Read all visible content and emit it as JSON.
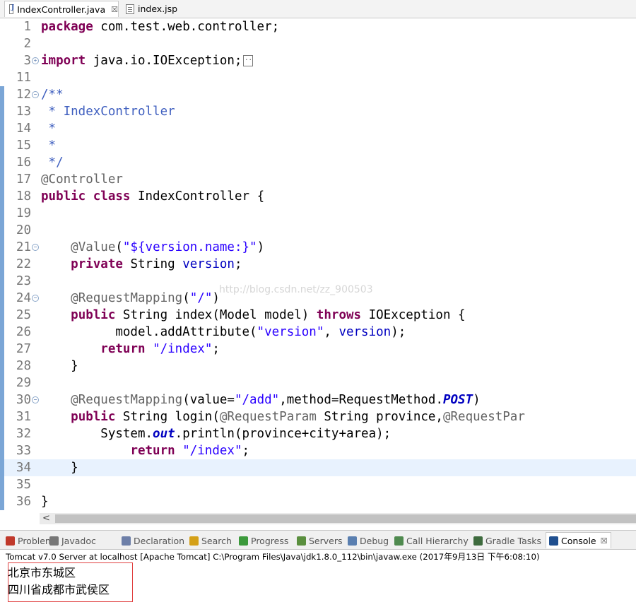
{
  "editor_tabs": [
    {
      "label": "IndexController.java",
      "close": "☒",
      "active": true
    },
    {
      "label": "index.jsp",
      "active": false
    }
  ],
  "code_lines": [
    {
      "n": "1",
      "tokens": [
        [
          "kw",
          "package"
        ],
        [
          "t",
          " com.test.web.controller;"
        ]
      ]
    },
    {
      "n": "2",
      "tokens": []
    },
    {
      "n": "3",
      "fold": "+",
      "tokens": [
        [
          "kw",
          "import"
        ],
        [
          "t",
          " java.io.IOException;"
        ]
      ],
      "collapsed": true
    },
    {
      "n": "11",
      "tokens": []
    },
    {
      "n": "12",
      "fold": "−",
      "bar": true,
      "tokens": [
        [
          "cm",
          "/**"
        ]
      ]
    },
    {
      "n": "13",
      "bar": true,
      "tokens": [
        [
          "cm",
          " * IndexController"
        ]
      ]
    },
    {
      "n": "14",
      "bar": true,
      "tokens": [
        [
          "cm",
          " *"
        ]
      ]
    },
    {
      "n": "15",
      "bar": true,
      "tokens": [
        [
          "cm",
          " *"
        ]
      ]
    },
    {
      "n": "16",
      "bar": true,
      "tokens": [
        [
          "cm",
          " */"
        ]
      ]
    },
    {
      "n": "17",
      "bar": true,
      "tokens": [
        [
          "an",
          "@Controller"
        ]
      ]
    },
    {
      "n": "18",
      "bar": true,
      "tokens": [
        [
          "kw",
          "public"
        ],
        [
          "t",
          " "
        ],
        [
          "kw",
          "class"
        ],
        [
          "t",
          " IndexController {"
        ]
      ]
    },
    {
      "n": "19",
      "bar": true,
      "tokens": []
    },
    {
      "n": "20",
      "bar": true,
      "tokens": []
    },
    {
      "n": "21",
      "fold": "−",
      "bar": true,
      "tokens": [
        [
          "t",
          "    "
        ],
        [
          "an",
          "@Value"
        ],
        [
          "t",
          "("
        ],
        [
          "st",
          "\"${version.name:}\""
        ],
        [
          "t",
          ")"
        ]
      ]
    },
    {
      "n": "22",
      "bar": true,
      "tokens": [
        [
          "t",
          "    "
        ],
        [
          "kw",
          "private"
        ],
        [
          "t",
          " String "
        ],
        [
          "fd",
          "version"
        ],
        [
          "t",
          ";"
        ]
      ]
    },
    {
      "n": "23",
      "bar": true,
      "tokens": []
    },
    {
      "n": "24",
      "fold": "−",
      "bar": true,
      "tokens": [
        [
          "t",
          "    "
        ],
        [
          "an",
          "@RequestMapping"
        ],
        [
          "t",
          "("
        ],
        [
          "st",
          "\"/\""
        ],
        [
          "t",
          ")"
        ]
      ]
    },
    {
      "n": "25",
      "bar": true,
      "tokens": [
        [
          "t",
          "    "
        ],
        [
          "kw",
          "public"
        ],
        [
          "t",
          " String index(Model model) "
        ],
        [
          "kw",
          "throws"
        ],
        [
          "t",
          " IOException {"
        ]
      ]
    },
    {
      "n": "26",
      "bar": true,
      "tokens": [
        [
          "t",
          "          model.addAttribute("
        ],
        [
          "st",
          "\"version\""
        ],
        [
          "t",
          ", "
        ],
        [
          "fd",
          "version"
        ],
        [
          "t",
          ");"
        ]
      ]
    },
    {
      "n": "27",
      "bar": true,
      "tokens": [
        [
          "t",
          "        "
        ],
        [
          "kw",
          "return"
        ],
        [
          "t",
          " "
        ],
        [
          "st",
          "\"/index\""
        ],
        [
          "t",
          ";"
        ]
      ]
    },
    {
      "n": "28",
      "bar": true,
      "tokens": [
        [
          "t",
          "    }"
        ]
      ]
    },
    {
      "n": "29",
      "bar": true,
      "tokens": []
    },
    {
      "n": "30",
      "fold": "−",
      "bar": true,
      "tokens": [
        [
          "t",
          "    "
        ],
        [
          "an",
          "@RequestMapping"
        ],
        [
          "t",
          "(value="
        ],
        [
          "st",
          "\"/add\""
        ],
        [
          "t",
          ",method=RequestMethod."
        ],
        [
          "sf",
          "POST"
        ],
        [
          "t",
          ")"
        ]
      ]
    },
    {
      "n": "31",
      "bar": true,
      "tokens": [
        [
          "t",
          "    "
        ],
        [
          "kw",
          "public"
        ],
        [
          "t",
          " String login("
        ],
        [
          "an",
          "@RequestParam"
        ],
        [
          "t",
          " String province,"
        ],
        [
          "an",
          "@RequestPar"
        ]
      ]
    },
    {
      "n": "32",
      "bar": true,
      "tokens": [
        [
          "t",
          "        System."
        ],
        [
          "sf",
          "out"
        ],
        [
          "t",
          ".println(province+city+area);"
        ]
      ]
    },
    {
      "n": "33",
      "bar": true,
      "tokens": [
        [
          "t",
          "            "
        ],
        [
          "kw",
          "return"
        ],
        [
          "t",
          " "
        ],
        [
          "st",
          "\"/index\""
        ],
        [
          "t",
          ";"
        ]
      ]
    },
    {
      "n": "34",
      "bar": true,
      "current": true,
      "tokens": [
        [
          "t",
          "    }"
        ]
      ]
    },
    {
      "n": "35",
      "bar": true,
      "tokens": []
    },
    {
      "n": "36",
      "bar": true,
      "tokens": [
        [
          "t",
          "}"
        ]
      ]
    }
  ],
  "watermark": "http://blog.csdn.net/zz_900503",
  "views_tabs": [
    {
      "label": "Problems",
      "icon": "problems-icon",
      "color": "#c0392b"
    },
    {
      "label": "Javadoc",
      "icon": "at-icon",
      "color": "#777777"
    },
    {
      "label": "Declaration",
      "icon": "declaration-icon",
      "color": "#6d7fa8"
    },
    {
      "label": "Search",
      "icon": "search-icon",
      "color": "#d4a017"
    },
    {
      "label": "Progress",
      "icon": "progress-icon",
      "color": "#3c9a3c"
    },
    {
      "label": "Servers",
      "icon": "servers-icon",
      "color": "#5a8f3e"
    },
    {
      "label": "Debug",
      "icon": "debug-icon",
      "color": "#5a7fb0"
    },
    {
      "label": "Call Hierarchy",
      "icon": "call-hierarchy-icon",
      "color": "#4f8a4f"
    },
    {
      "label": "Gradle Tasks",
      "icon": "gradle-icon",
      "color": "#3e6b3e"
    },
    {
      "label": "Console",
      "icon": "console-icon",
      "color": "#1f4f8f",
      "active": true,
      "close": "☒"
    }
  ],
  "console": {
    "title": "Tomcat v7.0 Server at localhost [Apache Tomcat] C:\\Program Files\\Java\\jdk1.8.0_112\\bin\\javaw.exe (2017年9月13日 下午6:08:10)",
    "output": [
      "北京市东城区",
      "四川省成都市武侯区"
    ]
  },
  "colors": {
    "keyword": "#7f0055",
    "comment": "#3f5fbf",
    "annotation": "#646464",
    "string": "#2a00ff",
    "field": "#0000c0",
    "highlight_box": "#e04040"
  }
}
